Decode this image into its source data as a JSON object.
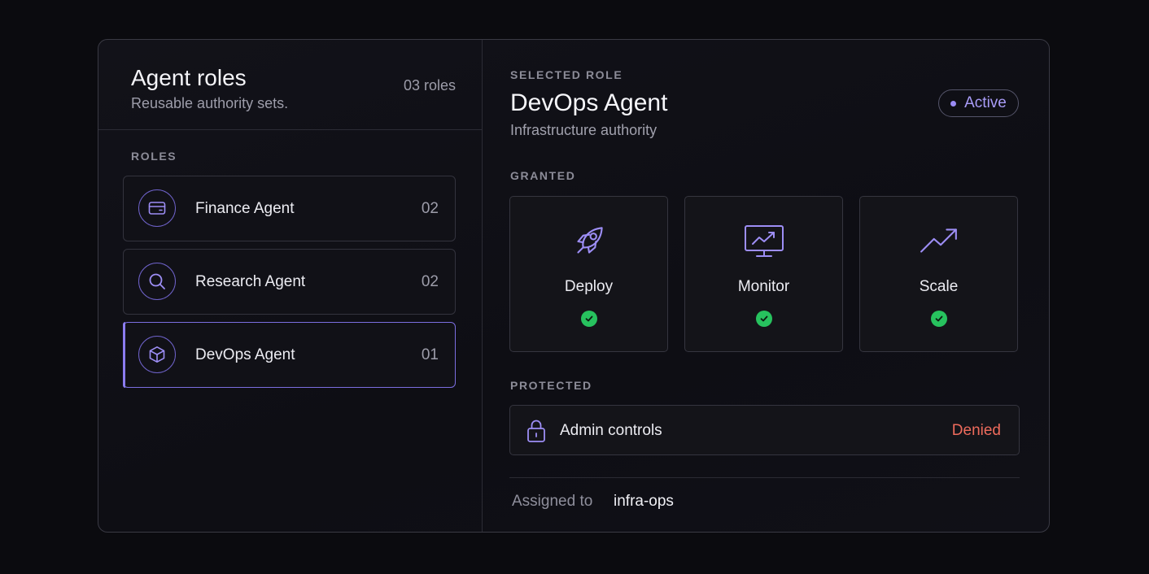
{
  "roles_panel": {
    "title": "Agent roles",
    "subtitle": "Reusable authority sets.",
    "count": "03 roles",
    "section_label": "ROLES",
    "items": [
      {
        "name": "Finance Agent",
        "count": "02",
        "icon": "credit-card-icon"
      },
      {
        "name": "Research Agent",
        "count": "02",
        "icon": "search-icon"
      },
      {
        "name": "DevOps Agent",
        "count": "01",
        "icon": "cube-icon",
        "selected": true
      }
    ]
  },
  "detail": {
    "section_label": "SELECTED ROLE",
    "title": "DevOps Agent",
    "subtitle": "Infrastructure authority",
    "status": "Active",
    "granted_label": "GRANTED",
    "granted": [
      {
        "label": "Deploy",
        "icon": "rocket-icon",
        "granted": true
      },
      {
        "label": "Monitor",
        "icon": "monitor-chart-icon",
        "granted": true
      },
      {
        "label": "Scale",
        "icon": "trend-up-icon",
        "granted": true
      }
    ],
    "protected_label": "PROTECTED",
    "protected": {
      "label": "Admin controls",
      "status": "Denied",
      "icon": "lock-icon"
    },
    "assigned_label": "Assigned to",
    "assigned_value": "infra-ops"
  },
  "colors": {
    "background": "#0b0b0f",
    "accent": "#8b7cf0",
    "success": "#27c25e",
    "danger": "#ee6b5c"
  }
}
